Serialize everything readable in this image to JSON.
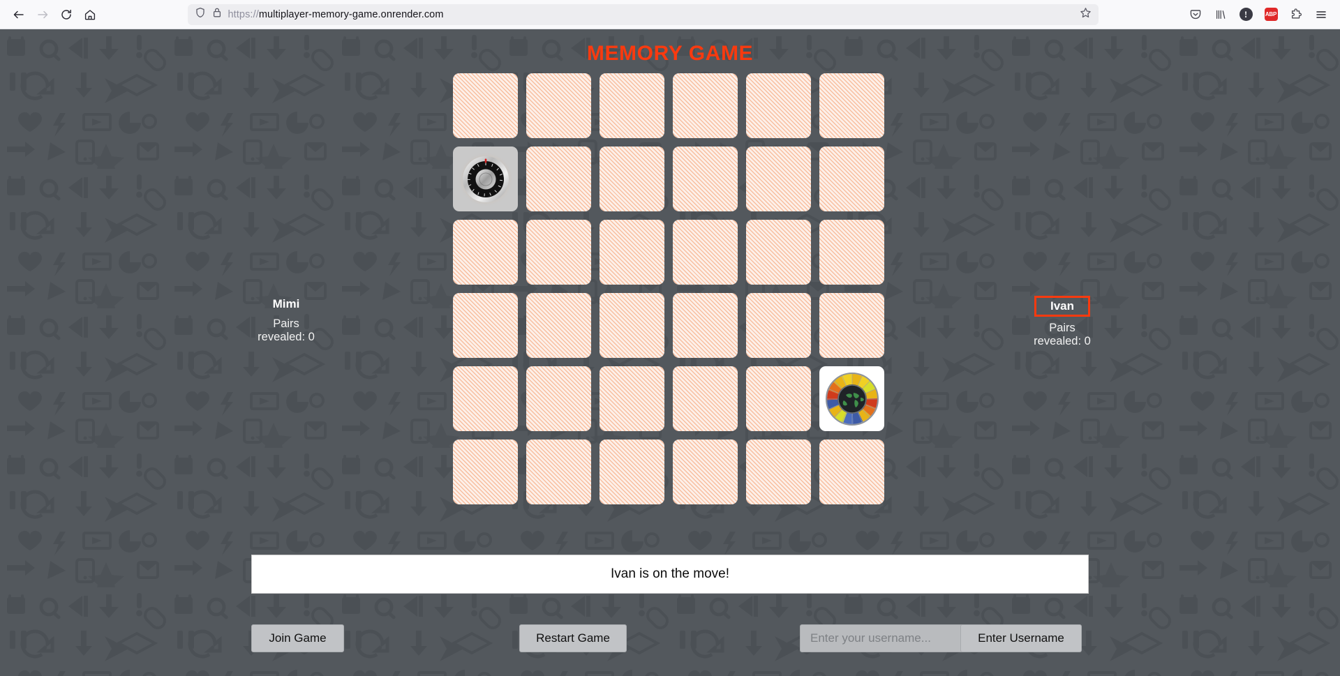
{
  "browser": {
    "back_icon": "arrow-left-icon",
    "forward_icon": "arrow-right-icon",
    "reload_icon": "reload-icon",
    "home_icon": "home-icon",
    "shield_icon": "shield-icon",
    "lock_icon": "lock-icon",
    "url_scheme": "https://",
    "url_host": "multiplayer-memory-game.onrender.com",
    "bookmark_icon": "star-icon",
    "toolbar_right": [
      {
        "name": "pocket-icon",
        "label": ""
      },
      {
        "name": "library-icon",
        "label": ""
      },
      {
        "name": "account-icon",
        "label": "!"
      },
      {
        "name": "adblock-icon",
        "label": "ABP"
      },
      {
        "name": "extensions-icon",
        "label": ""
      },
      {
        "name": "menu-icon",
        "label": ""
      }
    ]
  },
  "game": {
    "title": "MEMORY GAME",
    "title_color": "#f93a0f",
    "accent_color": "#f93a0f",
    "background_color": "#53585d",
    "card_back_color": "#fdf0e9",
    "grid": {
      "columns": 6,
      "rows": 6,
      "total_cards": 36
    },
    "cards": [
      {
        "index": 0,
        "state": "hidden"
      },
      {
        "index": 1,
        "state": "hidden"
      },
      {
        "index": 2,
        "state": "hidden"
      },
      {
        "index": 3,
        "state": "hidden"
      },
      {
        "index": 4,
        "state": "hidden"
      },
      {
        "index": 5,
        "state": "hidden"
      },
      {
        "index": 6,
        "state": "revealed",
        "face": "safe-dial-icon"
      },
      {
        "index": 7,
        "state": "hidden"
      },
      {
        "index": 8,
        "state": "hidden"
      },
      {
        "index": 9,
        "state": "hidden"
      },
      {
        "index": 10,
        "state": "hidden"
      },
      {
        "index": 11,
        "state": "hidden"
      },
      {
        "index": 12,
        "state": "hidden"
      },
      {
        "index": 13,
        "state": "hidden"
      },
      {
        "index": 14,
        "state": "hidden"
      },
      {
        "index": 15,
        "state": "hidden"
      },
      {
        "index": 16,
        "state": "hidden"
      },
      {
        "index": 17,
        "state": "hidden"
      },
      {
        "index": 18,
        "state": "hidden"
      },
      {
        "index": 19,
        "state": "hidden"
      },
      {
        "index": 20,
        "state": "hidden"
      },
      {
        "index": 21,
        "state": "hidden"
      },
      {
        "index": 22,
        "state": "hidden"
      },
      {
        "index": 23,
        "state": "hidden"
      },
      {
        "index": 24,
        "state": "hidden"
      },
      {
        "index": 25,
        "state": "hidden"
      },
      {
        "index": 26,
        "state": "hidden"
      },
      {
        "index": 27,
        "state": "hidden"
      },
      {
        "index": 28,
        "state": "hidden"
      },
      {
        "index": 29,
        "state": "revealed",
        "face": "world-clock-wheel-icon"
      },
      {
        "index": 30,
        "state": "hidden"
      },
      {
        "index": 31,
        "state": "hidden"
      },
      {
        "index": 32,
        "state": "hidden"
      },
      {
        "index": 33,
        "state": "hidden"
      },
      {
        "index": 34,
        "state": "hidden"
      },
      {
        "index": 35,
        "state": "hidden"
      }
    ],
    "players": [
      {
        "name": "Mimi",
        "score_label": "Pairs",
        "score_value": "revealed: 0",
        "pairs_revealed": 0,
        "active": false
      },
      {
        "name": "Ivan",
        "score_label": "Pairs",
        "score_value": "revealed: 0",
        "pairs_revealed": 0,
        "active": true
      }
    ],
    "status_message": "Ivan is on the move!",
    "controls": {
      "join_label": "Join Game",
      "restart_label": "Restart Game",
      "username_placeholder": "Enter your username...",
      "username_value": "",
      "username_button_label": "Enter Username"
    }
  }
}
